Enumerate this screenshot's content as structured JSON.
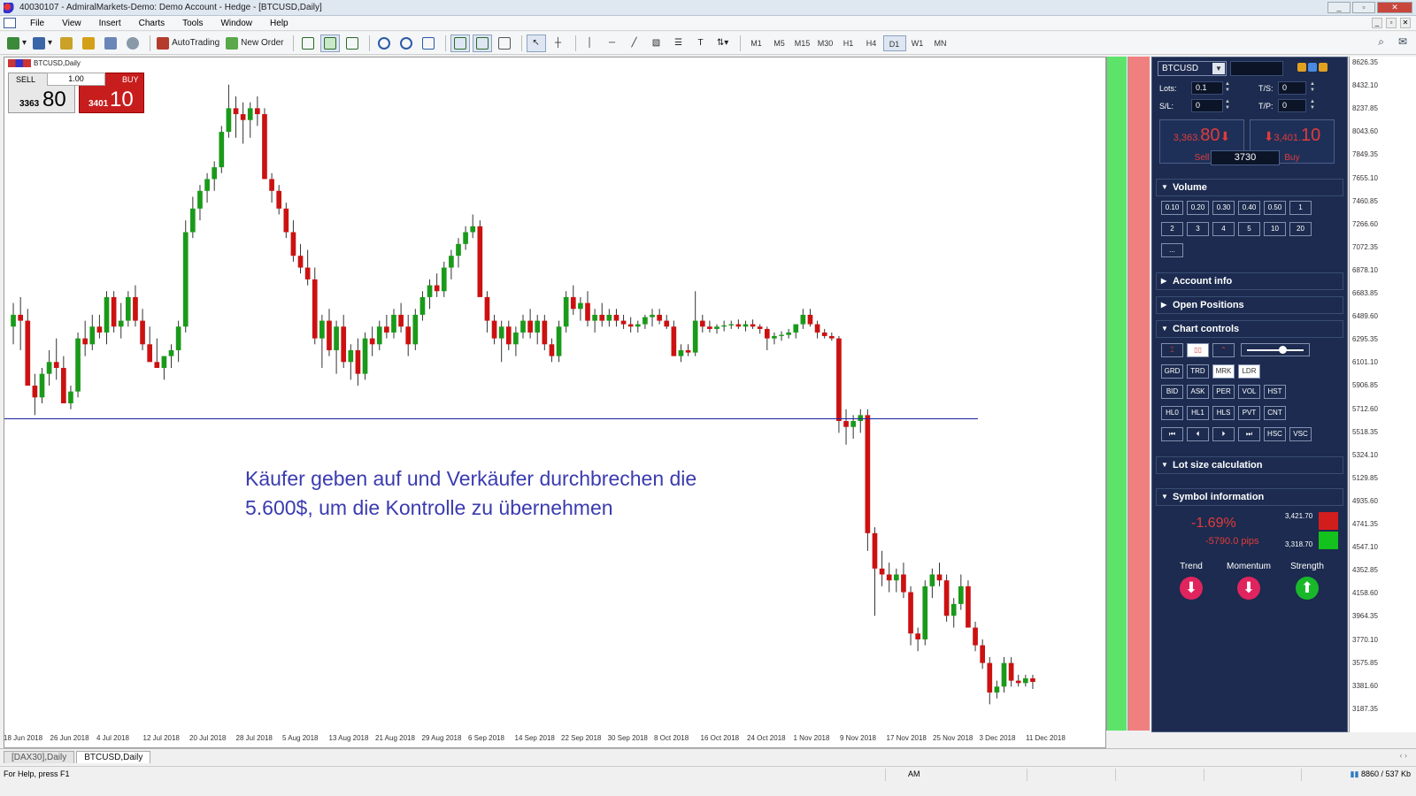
{
  "window": {
    "title": "40030107 - AdmiralMarkets-Demo: Demo Account - Hedge - [BTCUSD,Daily]",
    "controls": [
      "_",
      "▫",
      "✕"
    ]
  },
  "menu": [
    "File",
    "View",
    "Insert",
    "Charts",
    "Tools",
    "Window",
    "Help"
  ],
  "toolbar": {
    "autotrading": "AutoTrading",
    "new_order": "New Order",
    "timeframes": [
      "M1",
      "M5",
      "M15",
      "M30",
      "H1",
      "H4",
      "D1",
      "W1",
      "MN"
    ],
    "active_timeframe": "D1"
  },
  "chart": {
    "label": "BTCUSD,Daily",
    "one_click": {
      "sell_label": "SELL",
      "buy_label": "BUY",
      "lots": "1.00",
      "sell_small": "3363",
      "sell_big": "80",
      "buy_small": "3401",
      "buy_big": "10"
    },
    "annotation_line1": "Käufer geben auf und Verkäufer durchbrechen die",
    "annotation_line2": "5.600$, um die Kontrolle zu übernehmen",
    "x_ticks": [
      "18 Jun 2018",
      "26 Jun 2018",
      "4 Jul 2018",
      "12 Jul 2018",
      "20 Jul 2018",
      "28 Jul 2018",
      "5 Aug 2018",
      "13 Aug 2018",
      "21 Aug 2018",
      "29 Aug 2018",
      "6 Sep 2018",
      "14 Sep 2018",
      "22 Sep 2018",
      "30 Sep 2018",
      "8 Oct 2018",
      "16 Oct 2018",
      "24 Oct 2018",
      "1 Nov 2018",
      "9 Nov 2018",
      "17 Nov 2018",
      "25 Nov 2018",
      "3 Dec 2018",
      "11 Dec 2018"
    ],
    "y_ticks": [
      "8626.35",
      "8432.10",
      "8237.85",
      "8043.60",
      "7849.35",
      "7655.10",
      "7460.85",
      "7266.60",
      "7072.35",
      "6878.10",
      "6683.85",
      "6489.60",
      "6295.35",
      "6101.10",
      "5906.85",
      "5712.60",
      "5518.35",
      "5324.10",
      "5129.85",
      "4935.60",
      "4741.35",
      "4547.10",
      "4352.85",
      "4158.60",
      "3964.35",
      "3770.10",
      "3575.85",
      "3381.60",
      "3187.35"
    ],
    "y_min": 3120,
    "y_max": 8650,
    "support_level": 5620,
    "candle_colors": {
      "up": "#1a9a1a",
      "down": "#cc1111",
      "wick": "#333333"
    },
    "candles": [
      [
        6400,
        6600,
        6250,
        6500
      ],
      [
        6500,
        6650,
        6200,
        6450
      ],
      [
        6450,
        6550,
        6100,
        5900
      ],
      [
        5900,
        6000,
        5650,
        5800
      ],
      [
        5800,
        6050,
        5750,
        6000
      ],
      [
        6000,
        6200,
        5900,
        6100
      ],
      [
        6100,
        6300,
        5950,
        6050
      ],
      [
        6050,
        6150,
        5850,
        5750
      ],
      [
        5750,
        5900,
        5700,
        5850
      ],
      [
        5850,
        6350,
        5800,
        6300
      ],
      [
        6300,
        6450,
        6150,
        6250
      ],
      [
        6250,
        6500,
        6200,
        6400
      ],
      [
        6400,
        6500,
        6300,
        6350
      ],
      [
        6350,
        6700,
        6250,
        6650
      ],
      [
        6650,
        6700,
        6350,
        6400
      ],
      [
        6400,
        6600,
        6300,
        6450
      ],
      [
        6450,
        6700,
        6400,
        6650
      ],
      [
        6650,
        6750,
        6400,
        6450
      ],
      [
        6450,
        6550,
        6200,
        6250
      ],
      [
        6250,
        6400,
        6100,
        6100
      ],
      [
        6100,
        6300,
        6050,
        6050
      ],
      [
        6050,
        6150,
        5950,
        6150
      ],
      [
        6150,
        6250,
        6050,
        6200
      ],
      [
        6200,
        6450,
        6100,
        6400
      ],
      [
        6400,
        7300,
        6350,
        7200
      ],
      [
        7200,
        7500,
        7150,
        7400
      ],
      [
        7400,
        7600,
        7300,
        7550
      ],
      [
        7550,
        7700,
        7450,
        7650
      ],
      [
        7650,
        7800,
        7550,
        7750
      ],
      [
        7750,
        8100,
        7700,
        8050
      ],
      [
        8050,
        8450,
        8000,
        8250
      ],
      [
        8250,
        8350,
        8000,
        8200
      ],
      [
        8200,
        8300,
        7950,
        8150
      ],
      [
        8150,
        8300,
        8000,
        8250
      ],
      [
        8250,
        8350,
        8100,
        8200
      ],
      [
        8200,
        8250,
        7950,
        7650
      ],
      [
        7650,
        7700,
        7450,
        7550
      ],
      [
        7550,
        7600,
        7350,
        7400
      ],
      [
        7400,
        7450,
        7150,
        7200
      ],
      [
        7200,
        7300,
        6950,
        7000
      ],
      [
        7000,
        7100,
        6850,
        6900
      ],
      [
        6900,
        7050,
        6750,
        6800
      ],
      [
        6800,
        6900,
        6250,
        6300
      ],
      [
        6300,
        6500,
        6050,
        6450
      ],
      [
        6450,
        6550,
        6150,
        6200
      ],
      [
        6200,
        6450,
        6000,
        6400
      ],
      [
        6400,
        6500,
        6050,
        6100
      ],
      [
        6100,
        6250,
        5950,
        6200
      ],
      [
        6200,
        6300,
        5900,
        6000
      ],
      [
        6000,
        6350,
        5950,
        6300
      ],
      [
        6300,
        6400,
        6150,
        6250
      ],
      [
        6250,
        6450,
        6200,
        6400
      ],
      [
        6400,
        6500,
        6300,
        6350
      ],
      [
        6350,
        6550,
        6300,
        6500
      ],
      [
        6500,
        6600,
        6350,
        6400
      ],
      [
        6400,
        6500,
        6150,
        6250
      ],
      [
        6250,
        6550,
        6200,
        6500
      ],
      [
        6500,
        6700,
        6450,
        6650
      ],
      [
        6650,
        6800,
        6550,
        6750
      ],
      [
        6750,
        6850,
        6650,
        6700
      ],
      [
        6700,
        6950,
        6650,
        6900
      ],
      [
        6900,
        7050,
        6800,
        7000
      ],
      [
        7000,
        7150,
        6900,
        7100
      ],
      [
        7100,
        7250,
        7050,
        7200
      ],
      [
        7200,
        7350,
        7150,
        7250
      ],
      [
        7250,
        7300,
        6900,
        6650
      ],
      [
        6650,
        6700,
        6350,
        6450
      ],
      [
        6450,
        6500,
        6250,
        6300
      ],
      [
        6300,
        6450,
        6100,
        6400
      ],
      [
        6400,
        6450,
        6200,
        6250
      ],
      [
        6250,
        6400,
        6150,
        6350
      ],
      [
        6350,
        6500,
        6300,
        6450
      ],
      [
        6450,
        6550,
        6300,
        6350
      ],
      [
        6350,
        6500,
        6250,
        6450
      ],
      [
        6450,
        6500,
        6200,
        6250
      ],
      [
        6250,
        6300,
        6100,
        6150
      ],
      [
        6150,
        6450,
        6100,
        6400
      ],
      [
        6400,
        6700,
        6350,
        6650
      ],
      [
        6650,
        6750,
        6500,
        6550
      ],
      [
        6550,
        6650,
        6450,
        6600
      ],
      [
        6600,
        6700,
        6400,
        6450
      ],
      [
        6450,
        6550,
        6350,
        6500
      ],
      [
        6500,
        6600,
        6400,
        6450
      ],
      [
        6450,
        6550,
        6400,
        6500
      ],
      [
        6500,
        6550,
        6400,
        6450
      ],
      [
        6450,
        6500,
        6380,
        6420
      ],
      [
        6420,
        6480,
        6350,
        6400
      ],
      [
        6400,
        6450,
        6350,
        6420
      ],
      [
        6420,
        6500,
        6380,
        6480
      ],
      [
        6480,
        6550,
        6400,
        6500
      ],
      [
        6500,
        6550,
        6420,
        6450
      ],
      [
        6450,
        6500,
        6380,
        6400
      ],
      [
        6400,
        6450,
        6200,
        6150
      ],
      [
        6150,
        6250,
        6100,
        6200
      ],
      [
        6200,
        6250,
        6150,
        6180
      ],
      [
        6180,
        6700,
        6150,
        6450
      ],
      [
        6450,
        6500,
        6350,
        6400
      ],
      [
        6400,
        6450,
        6350,
        6380
      ],
      [
        6380,
        6420,
        6340,
        6400
      ],
      [
        6400,
        6450,
        6360,
        6410
      ],
      [
        6410,
        6450,
        6380,
        6420
      ],
      [
        6420,
        6460,
        6380,
        6400
      ],
      [
        6400,
        6450,
        6360,
        6420
      ],
      [
        6420,
        6460,
        6380,
        6400
      ],
      [
        6400,
        6420,
        6340,
        6380
      ],
      [
        6380,
        6400,
        6200,
        6300
      ],
      [
        6300,
        6350,
        6250,
        6320
      ],
      [
        6320,
        6360,
        6280,
        6330
      ],
      [
        6330,
        6380,
        6300,
        6350
      ],
      [
        6350,
        6400,
        6300,
        6420
      ],
      [
        6420,
        6550,
        6380,
        6500
      ],
      [
        6500,
        6550,
        6400,
        6420
      ],
      [
        6420,
        6450,
        6300,
        6350
      ],
      [
        6350,
        6380,
        6300,
        6320
      ],
      [
        6320,
        6350,
        6280,
        6300
      ],
      [
        6300,
        6320,
        5500,
        5600
      ],
      [
        5600,
        5700,
        5400,
        5550
      ],
      [
        5550,
        5650,
        5450,
        5600
      ],
      [
        5600,
        5700,
        5500,
        5650
      ],
      [
        5650,
        5700,
        4500,
        4650
      ],
      [
        4650,
        4700,
        3950,
        4350
      ],
      [
        4350,
        4500,
        4200,
        4300
      ],
      [
        4300,
        4400,
        4150,
        4250
      ],
      [
        4250,
        4350,
        4150,
        4300
      ],
      [
        4300,
        4400,
        4100,
        4150
      ],
      [
        4150,
        4200,
        3700,
        3800
      ],
      [
        3800,
        3850,
        3650,
        3750
      ],
      [
        3750,
        4250,
        3700,
        4200
      ],
      [
        4200,
        4350,
        4100,
        4300
      ],
      [
        4300,
        4400,
        4200,
        4250
      ],
      [
        4250,
        4300,
        3900,
        3950
      ],
      [
        3950,
        4100,
        3850,
        4050
      ],
      [
        4050,
        4300,
        4000,
        4200
      ],
      [
        4200,
        4250,
        3900,
        3850
      ],
      [
        3850,
        3900,
        3650,
        3700
      ],
      [
        3700,
        3750,
        3500,
        3550
      ],
      [
        3550,
        3600,
        3200,
        3300
      ],
      [
        3300,
        3400,
        3250,
        3350
      ],
      [
        3350,
        3600,
        3300,
        3550
      ],
      [
        3550,
        3600,
        3350,
        3400
      ],
      [
        3400,
        3450,
        3350,
        3380
      ],
      [
        3380,
        3450,
        3350,
        3420
      ],
      [
        3420,
        3450,
        3330,
        3390
      ]
    ]
  },
  "panel": {
    "symbol": "BTCUSD",
    "lots_label": "Lots:",
    "lots_value": "0.1",
    "ts_label": "T/S:",
    "ts_value": "0",
    "sl_label": "S/L:",
    "sl_value": "0",
    "tp_label": "T/P:",
    "tp_value": "0",
    "sell_price_small": "3,363.",
    "sell_price_big": "80",
    "buy_price_small": "3,401.",
    "buy_price_big": "10",
    "sell_label": "Sell",
    "buy_label": "Buy",
    "spread": "3730",
    "volume_title": "Volume",
    "volume_row1": [
      "0.10",
      "0.20",
      "0.30",
      "0.40",
      "0.50",
      "1"
    ],
    "volume_row2": [
      "2",
      "3",
      "4",
      "5",
      "10",
      "20"
    ],
    "volume_more": "...",
    "account_info": "Account info",
    "open_positions": "Open Positions",
    "chart_controls": "Chart controls",
    "cc_row2": [
      "GRD",
      "TRD",
      "MRK",
      "LDR"
    ],
    "cc_row3": [
      "BID",
      "ASK",
      "PER",
      "VOL",
      "HST"
    ],
    "cc_row4": [
      "HL0",
      "HL1",
      "HLS",
      "PVT",
      "CNT"
    ],
    "cc_row5": [
      "⏮",
      "⏴",
      "⏵",
      "⏭",
      "HSC",
      "VSC"
    ],
    "lot_size": "Lot size calculation",
    "symbol_info": "Symbol information",
    "change_pct": "-1.69%",
    "change_pips": "-5790.0 pips",
    "high": "3,421.70",
    "low": "3,318.70",
    "trend": "Trend",
    "momentum": "Momentum",
    "strength": "Strength"
  },
  "tabs": [
    "[DAX30],Daily",
    "BTCUSD,Daily"
  ],
  "status": {
    "help": "For Help, press F1",
    "mid": "AM",
    "traffic": "8860 / 537 Kb"
  }
}
